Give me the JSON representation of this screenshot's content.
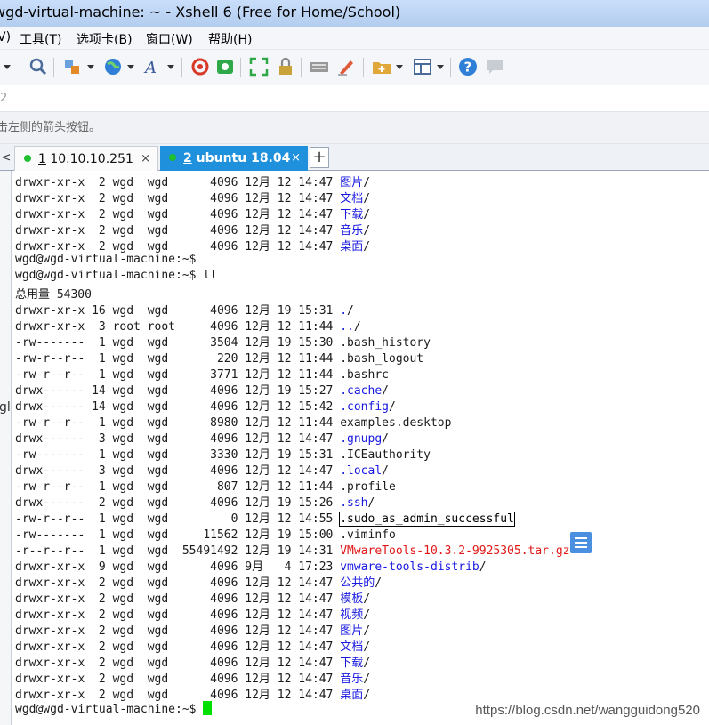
{
  "window": {
    "title": "wgd-virtual-machine: ~ - Xshell 6 (Free for Home/School)"
  },
  "menu": {
    "items": [
      "V)",
      "工具(T)",
      "选项卡(B)",
      "窗口(W)",
      "帮助(H)"
    ]
  },
  "toolbar": {
    "icons": [
      "caret-icon",
      "search-icon",
      "transfer-icon",
      "globe-icon",
      "font-icon",
      "xftp-icon",
      "xmanager-icon",
      "fullscreen-icon",
      "lock-icon",
      "keyboard-icon",
      "highlight-icon",
      "new-folder-icon",
      "layout-icon",
      "help-icon",
      "chat-icon"
    ]
  },
  "address": {
    "text": "2"
  },
  "hint": {
    "text": "击左侧的箭头按钮。"
  },
  "tabs": [
    {
      "num": "1",
      "label": " 10.10.10.251",
      "status_color": "#1fbf2f"
    },
    {
      "num": "2",
      "label": " ubuntu 18.04",
      "status_color": "#1fbf2f"
    }
  ],
  "tab_add_label": "+",
  "tab_close_label": "×",
  "tab_nav_label": "<",
  "left_panel": {
    "fragment": "gl"
  },
  "terminal": {
    "lines": [
      {
        "meta": "drwxr-xr-x  2 wgd  wgd      4096 12月 12 14:47 ",
        "name": "图片",
        "suffix": "/",
        "style": "blue"
      },
      {
        "meta": "drwxr-xr-x  2 wgd  wgd      4096 12月 12 14:47 ",
        "name": "文档",
        "suffix": "/",
        "style": "blue"
      },
      {
        "meta": "drwxr-xr-x  2 wgd  wgd      4096 12月 12 14:47 ",
        "name": "下载",
        "suffix": "/",
        "style": "blue"
      },
      {
        "meta": "drwxr-xr-x  2 wgd  wgd      4096 12月 12 14:47 ",
        "name": "音乐",
        "suffix": "/",
        "style": "blue"
      },
      {
        "meta": "drwxr-xr-x  2 wgd  wgd      4096 12月 12 14:47 ",
        "name": "桌面",
        "suffix": "/",
        "style": "blue"
      },
      {
        "meta": "wgd@wgd-virtual-machine:~$",
        "name": "",
        "suffix": "",
        "style": "plain"
      },
      {
        "meta": "wgd@wgd-virtual-machine:~$ ll",
        "name": "",
        "suffix": "",
        "style": "plain"
      },
      {
        "meta": "总用量 54300",
        "name": "",
        "suffix": "",
        "style": "plain"
      },
      {
        "meta": "drwxr-xr-x 16 wgd  wgd      4096 12月 19 15:31 ",
        "name": ".",
        "suffix": "/",
        "style": "blue"
      },
      {
        "meta": "drwxr-xr-x  3 root root     4096 12月 12 11:44 ",
        "name": "..",
        "suffix": "/",
        "style": "blue"
      },
      {
        "meta": "-rw-------  1 wgd  wgd      3504 12月 19 15:30 ",
        "name": ".bash_history",
        "suffix": "",
        "style": "plain"
      },
      {
        "meta": "-rw-r--r--  1 wgd  wgd       220 12月 12 11:44 ",
        "name": ".bash_logout",
        "suffix": "",
        "style": "plain"
      },
      {
        "meta": "-rw-r--r--  1 wgd  wgd      3771 12月 12 11:44 ",
        "name": ".bashrc",
        "suffix": "",
        "style": "plain"
      },
      {
        "meta": "drwx------ 14 wgd  wgd      4096 12月 19 15:27 ",
        "name": ".cache",
        "suffix": "/",
        "style": "blue"
      },
      {
        "meta": "drwx------ 14 wgd  wgd      4096 12月 12 15:42 ",
        "name": ".config",
        "suffix": "/",
        "style": "blue"
      },
      {
        "meta": "-rw-r--r--  1 wgd  wgd      8980 12月 12 11:44 ",
        "name": "examples.desktop",
        "suffix": "",
        "style": "plain"
      },
      {
        "meta": "drwx------  3 wgd  wgd      4096 12月 12 14:47 ",
        "name": ".gnupg",
        "suffix": "/",
        "style": "blue"
      },
      {
        "meta": "-rw-------  1 wgd  wgd      3330 12月 19 15:31 ",
        "name": ".ICEauthority",
        "suffix": "",
        "style": "plain"
      },
      {
        "meta": "drwx------  3 wgd  wgd      4096 12月 12 14:47 ",
        "name": ".local",
        "suffix": "/",
        "style": "blue"
      },
      {
        "meta": "-rw-r--r--  1 wgd  wgd       807 12月 12 11:44 ",
        "name": ".profile",
        "suffix": "",
        "style": "plain"
      },
      {
        "meta": "drwx------  2 wgd  wgd      4096 12月 19 15:26 ",
        "name": ".ssh",
        "suffix": "/",
        "style": "blue"
      },
      {
        "meta": "-rw-r--r--  1 wgd  wgd         0 12月 12 14:55 ",
        "name": ".sudo_as_admin_successful",
        "suffix": "",
        "style": "selected"
      },
      {
        "meta": "-rw-------  1 wgd  wgd     11562 12月 19 15:00 ",
        "name": ".viminfo",
        "suffix": "",
        "style": "plain"
      },
      {
        "meta": "-r--r--r--  1 wgd  wgd  55491492 12月 19 14:31 ",
        "name": "VMwareTools-10.3.2-9925305.tar.gz",
        "suffix": "",
        "style": "red"
      },
      {
        "meta": "drwxr-xr-x  9 wgd  wgd      4096 9月   4 17:23 ",
        "name": "vmware-tools-distrib",
        "suffix": "/",
        "style": "blue"
      },
      {
        "meta": "drwxr-xr-x  2 wgd  wgd      4096 12月 12 14:47 ",
        "name": "公共的",
        "suffix": "/",
        "style": "blue"
      },
      {
        "meta": "drwxr-xr-x  2 wgd  wgd      4096 12月 12 14:47 ",
        "name": "模板",
        "suffix": "/",
        "style": "blue"
      },
      {
        "meta": "drwxr-xr-x  2 wgd  wgd      4096 12月 12 14:47 ",
        "name": "视频",
        "suffix": "/",
        "style": "blue"
      },
      {
        "meta": "drwxr-xr-x  2 wgd  wgd      4096 12月 12 14:47 ",
        "name": "图片",
        "suffix": "/",
        "style": "blue"
      },
      {
        "meta": "drwxr-xr-x  2 wgd  wgd      4096 12月 12 14:47 ",
        "name": "文档",
        "suffix": "/",
        "style": "blue"
      },
      {
        "meta": "drwxr-xr-x  2 wgd  wgd      4096 12月 12 14:47 ",
        "name": "下载",
        "suffix": "/",
        "style": "blue"
      },
      {
        "meta": "drwxr-xr-x  2 wgd  wgd      4096 12月 12 14:47 ",
        "name": "音乐",
        "suffix": "/",
        "style": "blue"
      },
      {
        "meta": "drwxr-xr-x  2 wgd  wgd      4096 12月 12 14:47 ",
        "name": "桌面",
        "suffix": "/",
        "style": "blue"
      }
    ],
    "prompt": "wgd@wgd-virtual-machine:~$ ",
    "cursor_color": "#00e000"
  },
  "watermark": {
    "text": "https://blog.csdn.net/wangguidong520"
  },
  "colors": {
    "tab_active": "#1e90dc",
    "dir_blue": "#1818e0",
    "archive_red": "#e01818",
    "title_bar": "#c9defa"
  }
}
